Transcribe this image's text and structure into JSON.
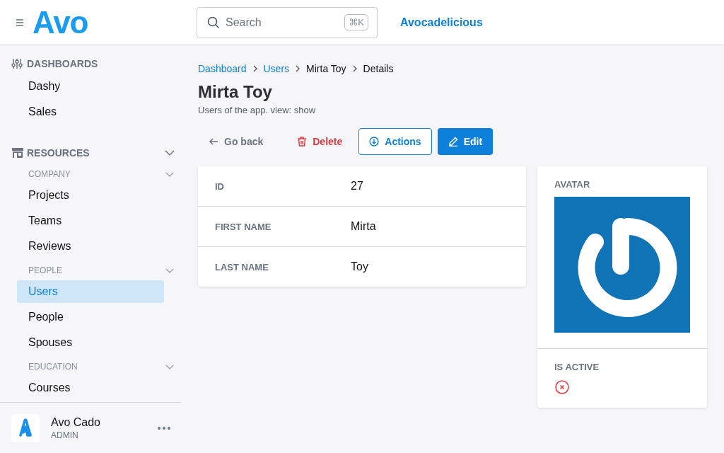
{
  "header": {
    "brand": "Avo",
    "search": {
      "placeholder": "Search",
      "shortcut": "⌘K"
    },
    "app_name": "Avocadelicious"
  },
  "sidebar": {
    "sections": [
      {
        "title": "DASHBOARDS",
        "kind": "dashboards",
        "collapsible": false,
        "items": [
          {
            "label": "Dashy",
            "selected": false
          },
          {
            "label": "Sales",
            "selected": false
          }
        ]
      },
      {
        "title": "RESOURCES",
        "kind": "resources",
        "collapsible": true,
        "groups": [
          {
            "title": "COMPANY",
            "items": [
              {
                "label": "Projects",
                "selected": false
              },
              {
                "label": "Teams",
                "selected": false
              },
              {
                "label": "Reviews",
                "selected": false
              }
            ]
          },
          {
            "title": "PEOPLE",
            "items": [
              {
                "label": "Users",
                "selected": true
              },
              {
                "label": "People",
                "selected": false
              },
              {
                "label": "Spouses",
                "selected": false
              }
            ]
          },
          {
            "title": "EDUCATION",
            "items": [
              {
                "label": "Courses",
                "selected": false
              }
            ]
          }
        ]
      }
    ],
    "user": {
      "name": "Avo Cado",
      "role": "ADMIN"
    }
  },
  "breadcrumbs": [
    {
      "label": "Dashboard",
      "link": true
    },
    {
      "label": "Users",
      "link": true
    },
    {
      "label": "Mirta Toy",
      "link": false
    },
    {
      "label": "Details",
      "link": false
    }
  ],
  "title": "Mirta Toy",
  "description": "Users of the app. view: show",
  "actions": [
    {
      "label": "Go back",
      "kind": "back"
    },
    {
      "label": "Delete",
      "kind": "delete"
    },
    {
      "label": "Actions",
      "kind": "actions"
    },
    {
      "label": "Edit",
      "kind": "edit"
    }
  ],
  "fields": [
    {
      "label": "ID",
      "value": "27"
    },
    {
      "label": "FIRST NAME",
      "value": "Mirta"
    },
    {
      "label": "LAST NAME",
      "value": "Toy"
    }
  ],
  "side_panel": {
    "avatar_label": "AVATAR",
    "active_label": "IS ACTIVE",
    "is_active": false
  }
}
